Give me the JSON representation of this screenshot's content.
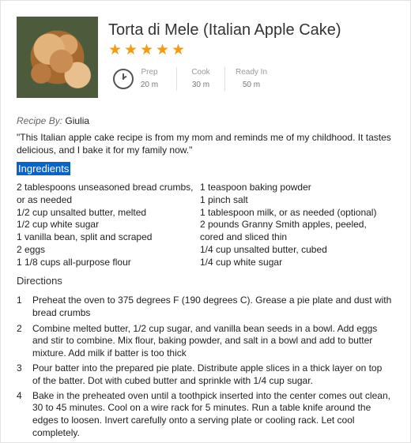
{
  "recipe": {
    "title": "Torta di Mele (Italian Apple Cake)",
    "rating": 5,
    "times": [
      {
        "label": "Prep",
        "value": "20 m"
      },
      {
        "label": "Cook",
        "value": "30 m"
      },
      {
        "label": "Ready In",
        "value": "50 m"
      }
    ],
    "recipe_by_label": "Recipe By:",
    "author": "Giulia",
    "description": "\"This Italian apple cake recipe is from my mom and reminds me of my childhood. It tastes delicious, and I bake it for my family now.\"",
    "ingredients_heading": "Ingredients",
    "ingredients_left": [
      "2 tablespoons unseasoned bread crumbs, or as needed",
      "1/2 cup unsalted butter, melted",
      "1/2 cup white sugar",
      "1 vanilla bean, split and scraped",
      "2 eggs",
      "1 1/8 cups all-purpose flour"
    ],
    "ingredients_right": [
      "1 teaspoon baking powder",
      "1 pinch salt",
      "1 tablespoon milk, or as needed (optional)",
      "2 pounds Granny Smith apples, peeled, cored and sliced thin",
      "1/4 cup unsalted butter, cubed",
      "1/4 cup white sugar"
    ],
    "directions_heading": "Directions",
    "directions": [
      {
        "num": "1",
        "text": "Preheat the oven to 375 degrees F (190 degrees C). Grease a pie plate and dust with bread crumbs"
      },
      {
        "num": "2",
        "text": "Combine melted butter, 1/2 cup sugar, and vanilla bean seeds in a bowl. Add eggs and stir to combine. Mix flour, baking powder, and salt in a bowl and add to butter mixture. Add milk if batter is too thick"
      },
      {
        "num": "3",
        "text": "Pour batter into the prepared pie plate. Distribute apple slices in a thick layer on top of the batter. Dot with cubed butter and sprinkle with 1/4 cup sugar."
      },
      {
        "num": "4",
        "text": "Bake in the preheated oven until a toothpick inserted into the center comes out clean, 30 to 45 minutes. Cool on a wire rack for 5 minutes. Run a table knife around the edges to loosen. Invert carefully onto a serving plate or cooling rack. Let cool completely."
      }
    ]
  },
  "icons": {
    "rating": "star-icon",
    "time": "clock-icon"
  },
  "colors": {
    "star": "#f39c12",
    "selection": "#0a63c9"
  }
}
